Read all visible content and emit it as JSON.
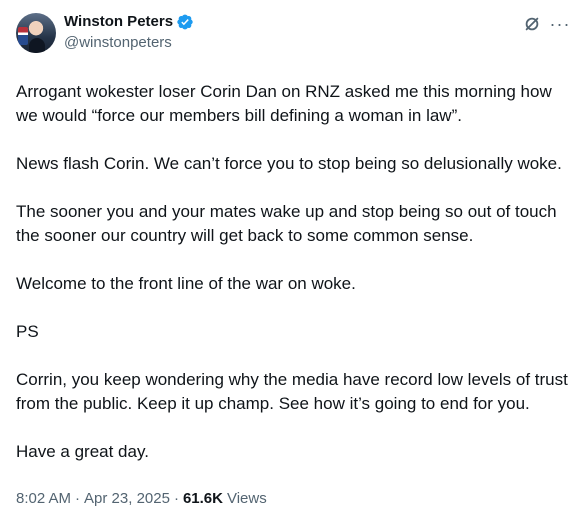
{
  "author": {
    "name": "Winston Peters",
    "handle": "@winstonpeters",
    "avatar_icon": "profile-photo",
    "verified_icon": "verified-badge-icon",
    "verified_color": "#1d9bf0"
  },
  "header_actions": {
    "grok_icon": "grok-icon",
    "more_label": "···"
  },
  "tweet": {
    "paragraphs": [
      "Arrogant wokester loser Corin Dan on RNZ asked me this morning how we would “force our members bill defining a woman in law”.",
      "News flash Corin. We can’t force you to stop being so delusionally woke.",
      "The sooner you and your mates wake up and stop being so out of touch the sooner our country will get back to some common sense.",
      "Welcome to the front line of the war on woke.",
      "PS",
      "Corrin, you keep wondering why the media have record low levels of trust from the public. Keep it up champ. See how it’s going to end for you.",
      "Have a great day."
    ]
  },
  "meta": {
    "time": "8:02 AM",
    "separator": "·",
    "date": "Apr 23, 2025",
    "views_count": "61.6K",
    "views_label": "Views"
  },
  "colors": {
    "text": "#0f1419",
    "secondary": "#536471",
    "verified": "#1d9bf0"
  }
}
